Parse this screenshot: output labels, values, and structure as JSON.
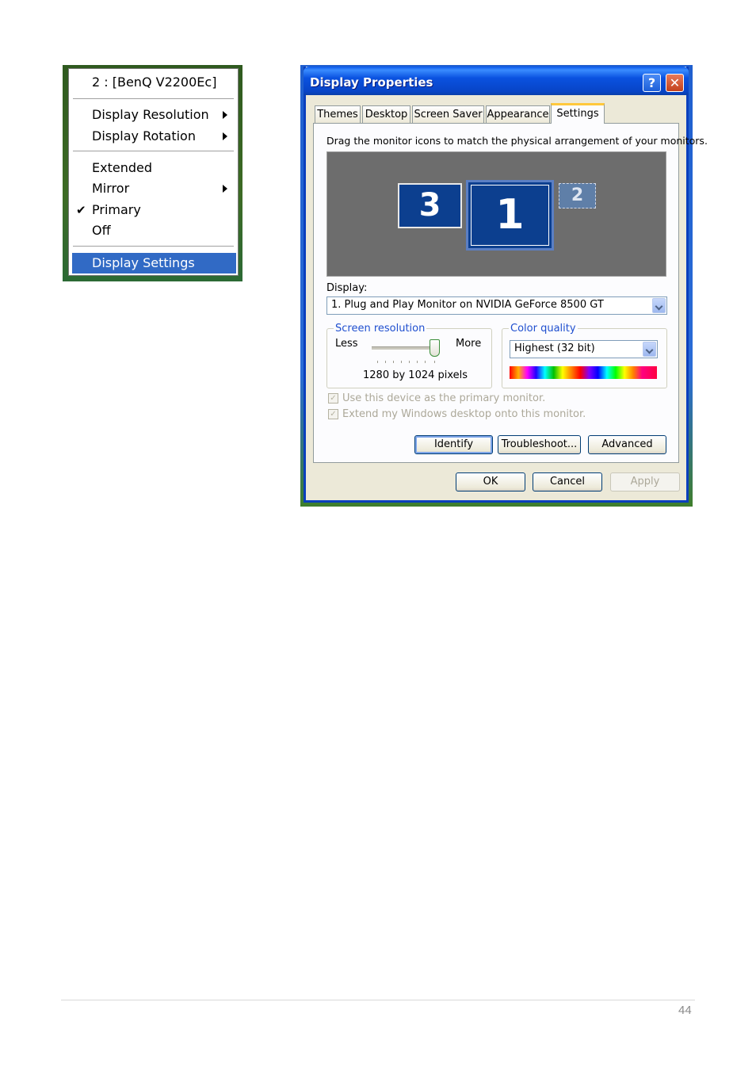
{
  "context_menu": {
    "header": "2 : [BenQ V2200Ec]",
    "items": [
      {
        "label": "Display Resolution",
        "submenu": true
      },
      {
        "label": "Display Rotation",
        "submenu": true
      },
      {
        "label": "Extended",
        "submenu": false
      },
      {
        "label": "Mirror",
        "submenu": true
      },
      {
        "label": "Primary",
        "checked": true
      },
      {
        "label": "Off",
        "submenu": false
      },
      {
        "label": "Display Settings",
        "selected": true
      }
    ]
  },
  "dialog": {
    "title": "Display Properties",
    "help_glyph": "?",
    "close_glyph": "✕",
    "tabs": [
      "Themes",
      "Desktop",
      "Screen Saver",
      "Appearance",
      "Settings"
    ],
    "active_tab": "Settings",
    "instruction": "Drag the monitor icons to match the physical arrangement of your monitors.",
    "monitors": {
      "primary": "1",
      "left": "3",
      "secondary": "2"
    },
    "display_label": "Display:",
    "display_value": "1. Plug and Play Monitor on NVIDIA GeForce 8500 GT",
    "screen_resolution": {
      "title": "Screen resolution",
      "less": "Less",
      "more": "More",
      "value": "1280 by 1024 pixels"
    },
    "color_quality": {
      "title": "Color quality",
      "value": "Highest (32 bit)"
    },
    "checkboxes": [
      {
        "label": "Use this device as the primary monitor.",
        "checked": true,
        "enabled": false
      },
      {
        "label": "Extend my Windows desktop onto this monitor.",
        "checked": true,
        "enabled": false
      }
    ],
    "panel_buttons": [
      "Identify",
      "Troubleshoot...",
      "Advanced"
    ],
    "footer_buttons": [
      "OK",
      "Cancel",
      "Apply"
    ]
  },
  "page": {
    "number": "44"
  },
  "colors": {
    "selection": "#316ac5",
    "titlebar": "#0a52e0",
    "monitor": "#0c3f8f"
  }
}
